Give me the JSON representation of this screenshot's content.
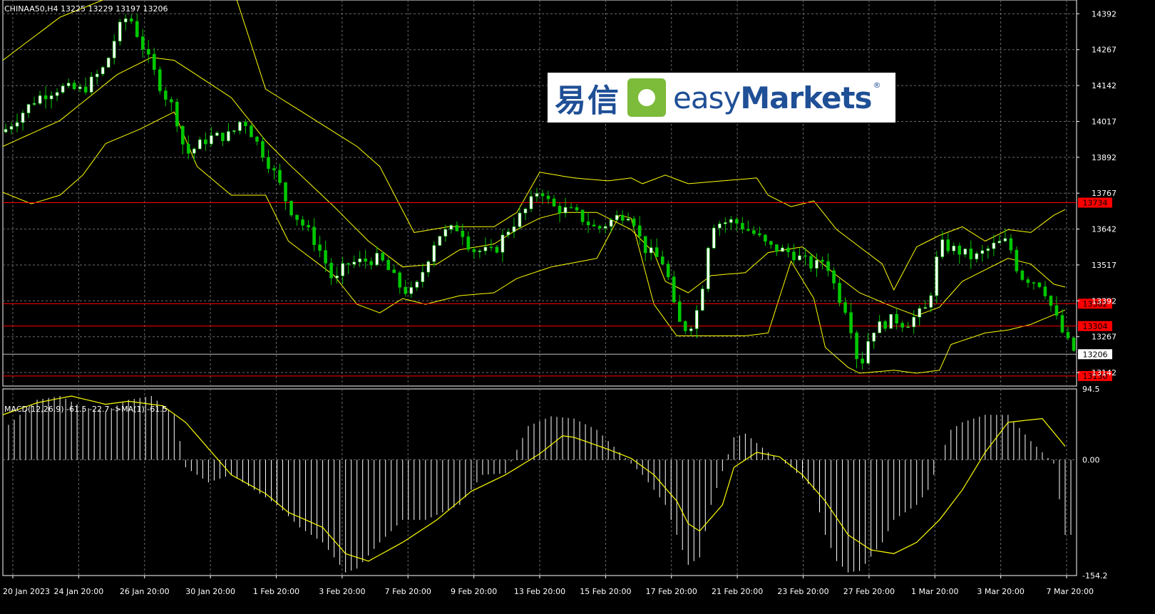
{
  "chart_data": {
    "type": "candlestick",
    "symbol_header": "CHINAA50,H4  13225 13229 13197 13206",
    "x_ticks": [
      "20 Jan 2023",
      "24 Jan 20:00",
      "26 Jan 20:00",
      "30 Jan 20:00",
      "1 Feb 20:00",
      "3 Feb 20:00",
      "7 Feb 20:00",
      "9 Feb 20:00",
      "13 Feb 20:00",
      "15 Feb 20:00",
      "17 Feb 20:00",
      "21 Feb 20:00",
      "23 Feb 20:00",
      "27 Feb 20:00",
      "1 Mar 20:00",
      "3 Mar 20:00",
      "7 Mar 20:00"
    ],
    "price_axis_ticks": [
      14392,
      14267,
      14142,
      14017,
      13892,
      13767,
      13642,
      13517,
      13392,
      13267,
      13142
    ],
    "price_range": [
      13095,
      14440
    ],
    "horizontal_lines": [
      {
        "label": "13734",
        "value": 13734,
        "color": "#ff0000"
      },
      {
        "label": "13382",
        "value": 13382,
        "color": "#ff0000"
      },
      {
        "label": "13304",
        "value": 13304,
        "color": "#ff0000"
      },
      {
        "label": "13130",
        "value": 13130,
        "color": "#ff0000"
      }
    ],
    "last_price": {
      "label": "13206",
      "value": 13206
    },
    "close_path": [
      [
        0,
        13980
      ],
      [
        6,
        14100
      ],
      [
        10,
        14135
      ],
      [
        14,
        14125
      ],
      [
        18,
        14210
      ],
      [
        20,
        14330
      ],
      [
        22,
        14390
      ],
      [
        24,
        14300
      ],
      [
        28,
        14120
      ],
      [
        30,
        14060
      ],
      [
        32,
        13900
      ],
      [
        36,
        13960
      ],
      [
        40,
        13970
      ],
      [
        42,
        14030
      ],
      [
        46,
        13890
      ],
      [
        48,
        13820
      ],
      [
        50,
        13720
      ],
      [
        54,
        13620
      ],
      [
        56,
        13550
      ],
      [
        58,
        13450
      ],
      [
        60,
        13520
      ],
      [
        66,
        13540
      ],
      [
        70,
        13430
      ],
      [
        72,
        13420
      ],
      [
        76,
        13620
      ],
      [
        80,
        13650
      ],
      [
        82,
        13570
      ],
      [
        86,
        13560
      ],
      [
        88,
        13630
      ],
      [
        92,
        13720
      ],
      [
        94,
        13790
      ],
      [
        96,
        13720
      ],
      [
        100,
        13700
      ],
      [
        104,
        13640
      ],
      [
        108,
        13690
      ],
      [
        110,
        13700
      ],
      [
        112,
        13580
      ],
      [
        116,
        13520
      ],
      [
        118,
        13320
      ],
      [
        120,
        13290
      ],
      [
        122,
        13380
      ],
      [
        124,
        13660
      ],
      [
        128,
        13670
      ],
      [
        132,
        13620
      ],
      [
        134,
        13580
      ],
      [
        138,
        13560
      ],
      [
        142,
        13510
      ],
      [
        144,
        13540
      ],
      [
        146,
        13420
      ],
      [
        148,
        13350
      ],
      [
        150,
        13150
      ],
      [
        152,
        13290
      ],
      [
        156,
        13330
      ],
      [
        158,
        13310
      ],
      [
        160,
        13340
      ],
      [
        162,
        13370
      ],
      [
        164,
        13590
      ],
      [
        168,
        13560
      ],
      [
        170,
        13540
      ],
      [
        174,
        13590
      ],
      [
        176,
        13600
      ],
      [
        178,
        13480
      ],
      [
        182,
        13450
      ],
      [
        184,
        13350
      ],
      [
        186,
        13260
      ],
      [
        188,
        13206
      ]
    ],
    "bollinger": {
      "color": "#ffff00",
      "upper_path": [
        [
          0,
          14230
        ],
        [
          10,
          14380
        ],
        [
          30,
          14540
        ],
        [
          40,
          14500
        ],
        [
          46,
          14130
        ],
        [
          50,
          14080
        ],
        [
          58,
          13980
        ],
        [
          62,
          13930
        ],
        [
          66,
          13860
        ],
        [
          72,
          13630
        ],
        [
          78,
          13650
        ],
        [
          86,
          13650
        ],
        [
          90,
          13700
        ],
        [
          94,
          13840
        ],
        [
          100,
          13820
        ],
        [
          106,
          13810
        ],
        [
          110,
          13820
        ],
        [
          112,
          13800
        ],
        [
          116,
          13830
        ],
        [
          120,
          13800
        ],
        [
          126,
          13810
        ],
        [
          132,
          13820
        ],
        [
          134,
          13760
        ],
        [
          138,
          13720
        ],
        [
          142,
          13740
        ],
        [
          146,
          13640
        ],
        [
          150,
          13580
        ],
        [
          154,
          13520
        ],
        [
          156,
          13430
        ],
        [
          160,
          13580
        ],
        [
          164,
          13620
        ],
        [
          168,
          13650
        ],
        [
          172,
          13600
        ],
        [
          176,
          13640
        ],
        [
          180,
          13630
        ],
        [
          184,
          13690
        ],
        [
          186,
          13710
        ]
      ],
      "middle_path": [
        [
          0,
          13930
        ],
        [
          10,
          14020
        ],
        [
          20,
          14180
        ],
        [
          26,
          14240
        ],
        [
          30,
          14230
        ],
        [
          40,
          14100
        ],
        [
          46,
          13950
        ],
        [
          50,
          13870
        ],
        [
          58,
          13720
        ],
        [
          64,
          13600
        ],
        [
          70,
          13510
        ],
        [
          76,
          13520
        ],
        [
          80,
          13570
        ],
        [
          86,
          13590
        ],
        [
          90,
          13640
        ],
        [
          94,
          13680
        ],
        [
          98,
          13700
        ],
        [
          104,
          13700
        ],
        [
          110,
          13640
        ],
        [
          114,
          13560
        ],
        [
          116,
          13460
        ],
        [
          120,
          13420
        ],
        [
          124,
          13480
        ],
        [
          130,
          13490
        ],
        [
          134,
          13560
        ],
        [
          140,
          13580
        ],
        [
          146,
          13480
        ],
        [
          150,
          13420
        ],
        [
          156,
          13370
        ],
        [
          160,
          13340
        ],
        [
          164,
          13370
        ],
        [
          168,
          13460
        ],
        [
          172,
          13500
        ],
        [
          176,
          13540
        ],
        [
          180,
          13520
        ],
        [
          184,
          13450
        ],
        [
          186,
          13440
        ]
      ],
      "lower_path": [
        [
          0,
          13770
        ],
        [
          5,
          13730
        ],
        [
          10,
          13760
        ],
        [
          14,
          13830
        ],
        [
          18,
          13940
        ],
        [
          24,
          13990
        ],
        [
          30,
          14050
        ],
        [
          34,
          13860
        ],
        [
          40,
          13760
        ],
        [
          46,
          13760
        ],
        [
          50,
          13600
        ],
        [
          58,
          13480
        ],
        [
          62,
          13380
        ],
        [
          66,
          13350
        ],
        [
          70,
          13400
        ],
        [
          74,
          13380
        ],
        [
          80,
          13410
        ],
        [
          86,
          13420
        ],
        [
          90,
          13470
        ],
        [
          96,
          13510
        ],
        [
          104,
          13540
        ],
        [
          108,
          13690
        ],
        [
          110,
          13680
        ],
        [
          114,
          13380
        ],
        [
          118,
          13270
        ],
        [
          124,
          13270
        ],
        [
          130,
          13270
        ],
        [
          134,
          13280
        ],
        [
          138,
          13530
        ],
        [
          142,
          13400
        ],
        [
          144,
          13230
        ],
        [
          148,
          13160
        ],
        [
          150,
          13140
        ],
        [
          156,
          13150
        ],
        [
          160,
          13140
        ],
        [
          164,
          13150
        ],
        [
          166,
          13240
        ],
        [
          172,
          13280
        ],
        [
          176,
          13290
        ],
        [
          180,
          13310
        ],
        [
          186,
          13360
        ]
      ]
    },
    "macd": {
      "label": "MACD(12,26,9) -61.5 -22.7  ->MA(1) -61.5",
      "axis_ticks": [
        94.5,
        0.0,
        -154.2
      ],
      "axis_tick_labels": [
        "94.5",
        "0.00",
        "-154.2"
      ],
      "range": [
        -154.2,
        94.5
      ],
      "histogram_color": "#ffffff",
      "signal_color": "#ffff00",
      "histogram_path": [
        [
          0,
          40
        ],
        [
          6,
          80
        ],
        [
          10,
          85
        ],
        [
          14,
          70
        ],
        [
          18,
          65
        ],
        [
          22,
          80
        ],
        [
          26,
          85
        ],
        [
          30,
          60
        ],
        [
          32,
          -10
        ],
        [
          36,
          -30
        ],
        [
          40,
          -20
        ],
        [
          44,
          -40
        ],
        [
          48,
          -60
        ],
        [
          52,
          -90
        ],
        [
          56,
          -110
        ],
        [
          60,
          -150
        ],
        [
          62,
          -145
        ],
        [
          66,
          -110
        ],
        [
          70,
          -80
        ],
        [
          74,
          -80
        ],
        [
          80,
          -60
        ],
        [
          84,
          -20
        ],
        [
          88,
          -18
        ],
        [
          92,
          45
        ],
        [
          96,
          58
        ],
        [
          100,
          55
        ],
        [
          104,
          40
        ],
        [
          108,
          10
        ],
        [
          110,
          -5
        ],
        [
          112,
          -20
        ],
        [
          116,
          -60
        ],
        [
          120,
          -140
        ],
        [
          122,
          -130
        ],
        [
          124,
          -60
        ],
        [
          128,
          30
        ],
        [
          130,
          35
        ],
        [
          134,
          10
        ],
        [
          138,
          -10
        ],
        [
          142,
          -40
        ],
        [
          144,
          -100
        ],
        [
          146,
          -135
        ],
        [
          148,
          -150
        ],
        [
          150,
          -148
        ],
        [
          154,
          -110
        ],
        [
          156,
          -80
        ],
        [
          160,
          -60
        ],
        [
          162,
          -40
        ],
        [
          164,
          0
        ],
        [
          166,
          40
        ],
        [
          168,
          50
        ],
        [
          172,
          60
        ],
        [
          176,
          60
        ],
        [
          180,
          25
        ],
        [
          184,
          -5
        ],
        [
          186,
          -100
        ]
      ],
      "signal_path": [
        [
          0,
          60
        ],
        [
          6,
          76
        ],
        [
          12,
          85
        ],
        [
          18,
          74
        ],
        [
          22,
          78
        ],
        [
          28,
          72
        ],
        [
          32,
          50
        ],
        [
          36,
          15
        ],
        [
          40,
          -20
        ],
        [
          46,
          -45
        ],
        [
          50,
          -70
        ],
        [
          56,
          -90
        ],
        [
          60,
          -125
        ],
        [
          64,
          -135
        ],
        [
          70,
          -110
        ],
        [
          76,
          -80
        ],
        [
          82,
          -42
        ],
        [
          88,
          -20
        ],
        [
          94,
          8
        ],
        [
          98,
          32
        ],
        [
          100,
          30
        ],
        [
          106,
          14
        ],
        [
          110,
          2
        ],
        [
          114,
          -20
        ],
        [
          118,
          -55
        ],
        [
          120,
          -85
        ],
        [
          122,
          -95
        ],
        [
          126,
          -60
        ],
        [
          128,
          -10
        ],
        [
          132,
          10
        ],
        [
          136,
          4
        ],
        [
          140,
          -20
        ],
        [
          144,
          -55
        ],
        [
          148,
          -100
        ],
        [
          152,
          -120
        ],
        [
          156,
          -125
        ],
        [
          160,
          -110
        ],
        [
          164,
          -80
        ],
        [
          168,
          -40
        ],
        [
          172,
          10
        ],
        [
          176,
          50
        ],
        [
          182,
          55
        ],
        [
          186,
          18
        ]
      ]
    },
    "colors": {
      "background": "#000000",
      "grid": "#6b6b6b",
      "bull_candle": "#ffffff",
      "bear_candle": "#00c800",
      "axis_text": "#ffffff",
      "hline_label_bg": "#ff0000",
      "last_price_bg": "#ffffff",
      "last_price_text": "#000000"
    }
  },
  "logo": {
    "chinese": "易信",
    "english_light": "easy",
    "english_bold": "Markets",
    "registered": "®"
  }
}
